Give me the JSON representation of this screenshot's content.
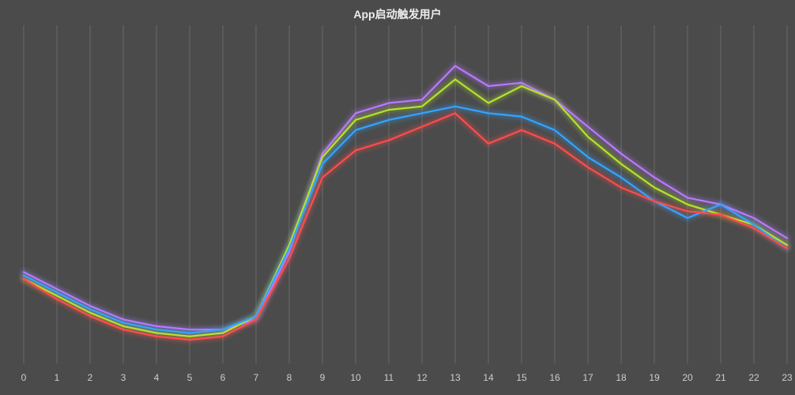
{
  "chart_data": {
    "type": "line",
    "title": "App启动触发用户",
    "xlabel": "",
    "ylabel": "",
    "categories": [
      "0",
      "1",
      "2",
      "3",
      "4",
      "5",
      "6",
      "7",
      "8",
      "9",
      "10",
      "11",
      "12",
      "13",
      "14",
      "15",
      "16",
      "17",
      "18",
      "19",
      "20",
      "21",
      "22",
      "23"
    ],
    "ylim": [
      0,
      100
    ],
    "grid": true,
    "legend": false,
    "series": [
      {
        "name": "series-purple",
        "color": "#b87aff",
        "values": [
          27,
          22,
          17,
          13,
          11,
          10,
          10,
          13,
          33,
          62,
          74,
          77,
          78,
          88,
          82,
          83,
          78,
          70,
          62,
          55,
          49,
          47,
          43,
          37
        ]
      },
      {
        "name": "series-green",
        "color": "#b6e22e",
        "values": [
          25,
          20,
          15,
          11,
          9,
          8,
          9,
          14,
          35,
          61,
          72,
          75,
          76,
          84,
          77,
          82,
          78,
          67,
          59,
          52,
          47,
          44,
          41,
          35
        ]
      },
      {
        "name": "series-blue",
        "color": "#34a4ff",
        "values": [
          26,
          21,
          16,
          12,
          10,
          9,
          10,
          14,
          34,
          59,
          69,
          72,
          74,
          76,
          74,
          73,
          69,
          61,
          55,
          48,
          43,
          47,
          41,
          34
        ]
      },
      {
        "name": "series-red",
        "color": "#ff4c4c",
        "values": [
          25,
          19,
          14,
          10,
          8,
          7,
          8,
          13,
          31,
          55,
          63,
          66,
          70,
          74,
          65,
          69,
          65,
          58,
          52,
          48,
          45,
          44,
          40,
          34
        ]
      }
    ]
  }
}
